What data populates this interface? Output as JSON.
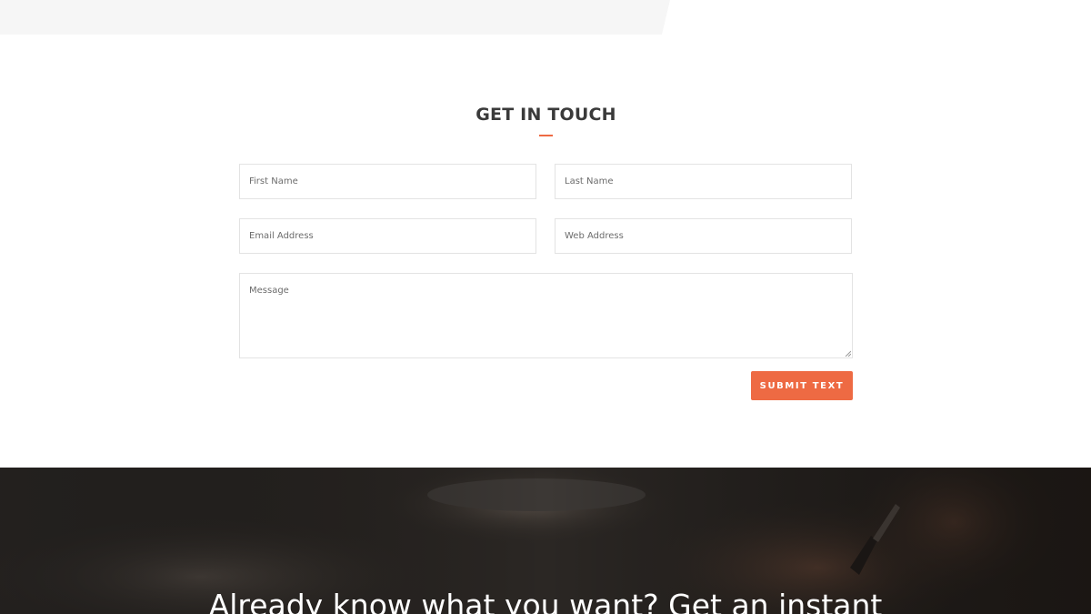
{
  "contact": {
    "heading": "GET IN TOUCH",
    "accent_color": "#ee6a43",
    "fields": {
      "first_name_placeholder": "First Name",
      "last_name_placeholder": "Last Name",
      "email_placeholder": "Email Address",
      "web_placeholder": "Web Address",
      "message_placeholder": "Message"
    },
    "submit_label": "SUBMIT TEXT"
  },
  "banner": {
    "headline": "Already know what you want? Get an instant"
  }
}
